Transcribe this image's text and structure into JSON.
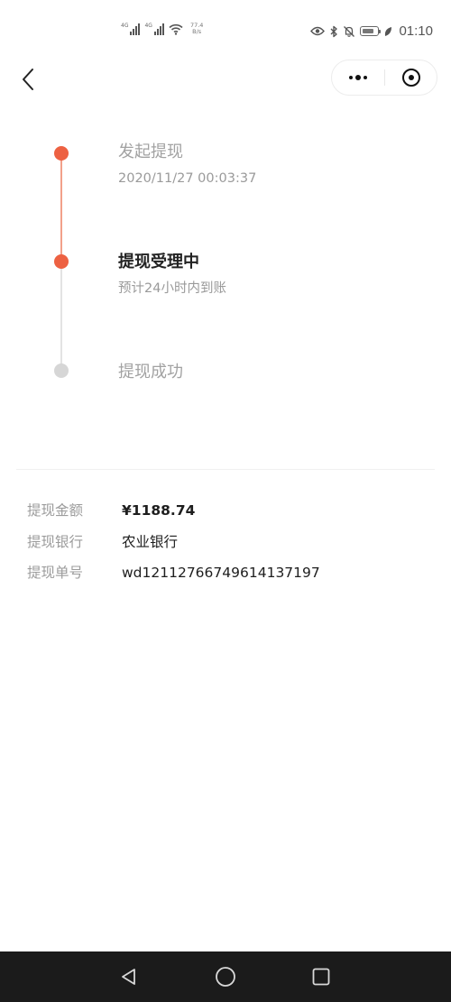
{
  "status_bar": {
    "signal_1_tag": "4G",
    "signal_2_tag": "4G",
    "net_speed_value": "77.4",
    "net_speed_unit": "B/s",
    "time": "01:10"
  },
  "nav": {
    "back_icon": "chevron-left-icon",
    "more_icon": "more-dots-icon",
    "close_icon": "target-close-icon"
  },
  "timeline": {
    "steps": [
      {
        "title": "发起提现",
        "subtitle": "2020/11/27 00:03:37",
        "state": "done"
      },
      {
        "title": "提现受理中",
        "subtitle": "预计24小时内到账",
        "state": "current"
      },
      {
        "title": "提现成功",
        "subtitle": "",
        "state": "pending"
      }
    ],
    "active_color": "#ed6142",
    "pending_color": "#d6d6d6"
  },
  "details": [
    {
      "label": "提现金额",
      "value": "¥1188.74"
    },
    {
      "label": "提现银行",
      "value": "农业银行"
    },
    {
      "label": "提现单号",
      "value": "wd12112766749614137197"
    }
  ],
  "system_nav": {
    "back_icon": "triangle-back-icon",
    "home_icon": "circle-home-icon",
    "recent_icon": "square-recent-icon"
  }
}
